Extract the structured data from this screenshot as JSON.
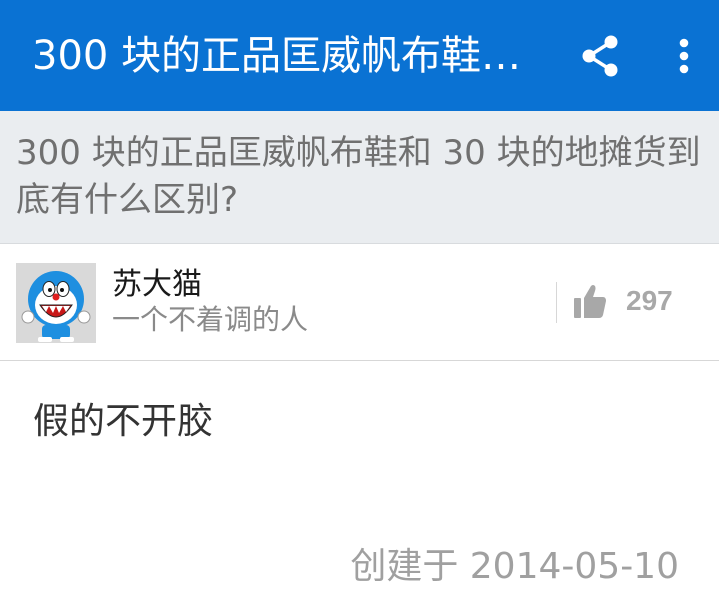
{
  "colors": {
    "appbar": "#0a72d3",
    "question_bg": "#eaedf0",
    "vote_count": "#a8a8a8",
    "meta_text": "#a0a0a0"
  },
  "appbar": {
    "title": "300 块的正品匡威帆布鞋…",
    "share_icon": "share-icon",
    "more_icon": "more-vert-icon"
  },
  "question": {
    "title": "300 块的正品匡威帆布鞋和 30 块的地摊货到底有什么区别?"
  },
  "author": {
    "name": "苏大猫",
    "bio": "一个不着调的人",
    "avatar_icon": "doraemon-avatar"
  },
  "vote": {
    "icon": "thumbs-up-icon",
    "count": "297"
  },
  "answer": {
    "body": "假的不开胶",
    "created": "创建于 2014-05-10"
  }
}
